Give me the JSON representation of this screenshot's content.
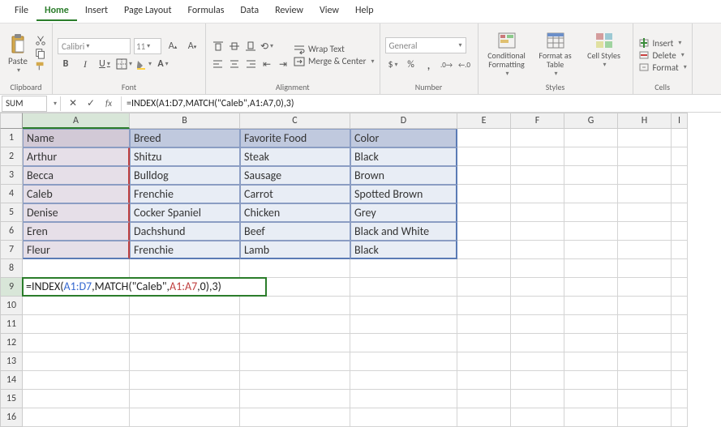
{
  "menu": {
    "items": [
      "File",
      "Home",
      "Insert",
      "Page Layout",
      "Formulas",
      "Data",
      "Review",
      "View",
      "Help"
    ],
    "active": "Home"
  },
  "ribbon": {
    "clipboard": {
      "label": "Clipboard",
      "paste": "Paste"
    },
    "font": {
      "label": "Font",
      "name": "Calibri",
      "size": "11",
      "b": "B",
      "i": "I",
      "u": "U"
    },
    "alignment": {
      "label": "Alignment",
      "wrap": "Wrap Text",
      "merge": "Merge & Center"
    },
    "number": {
      "label": "Number",
      "format": "General"
    },
    "styles": {
      "label": "Styles",
      "cond": "Conditional Formatting",
      "table": "Format as Table",
      "cell": "Cell Styles"
    },
    "cells": {
      "label": "Cells",
      "insert": "Insert",
      "delete": "Delete",
      "format": "Format"
    }
  },
  "name_box": "SUM",
  "formula_bar": "=INDEX(A1:D7,MATCH(\"Caleb\",A1:A7,0),3)",
  "columns": [
    "A",
    "B",
    "C",
    "D",
    "E",
    "F",
    "G",
    "H",
    "I"
  ],
  "rows": [
    "1",
    "2",
    "3",
    "4",
    "5",
    "6",
    "7",
    "8",
    "9",
    "10",
    "11",
    "12",
    "13",
    "14",
    "15",
    "16"
  ],
  "table": {
    "header": [
      "Name",
      "Breed",
      "Favorite Food",
      "Color"
    ],
    "r2": [
      "Arthur",
      "Shitzu",
      "Steak",
      "Black"
    ],
    "r3": [
      "Becca",
      "Bulldog",
      "Sausage",
      "Brown"
    ],
    "r4": [
      "Caleb",
      "Frenchie",
      "Carrot",
      "Spotted Brown"
    ],
    "r5": [
      "Denise",
      "Cocker Spaniel",
      "Chicken",
      "Grey"
    ],
    "r6": [
      "Eren",
      "Dachshund",
      "Beef",
      "Black and White"
    ],
    "r7": [
      "Fleur",
      "Frenchie",
      "Lamb",
      "Black"
    ]
  },
  "edit": {
    "p1a": "=INDEX(",
    "p2a": "A1:D7",
    "p1b": ",MATCH(\"Caleb\",",
    "p3a": "A1:A7",
    "p1c": ",0),3)"
  }
}
